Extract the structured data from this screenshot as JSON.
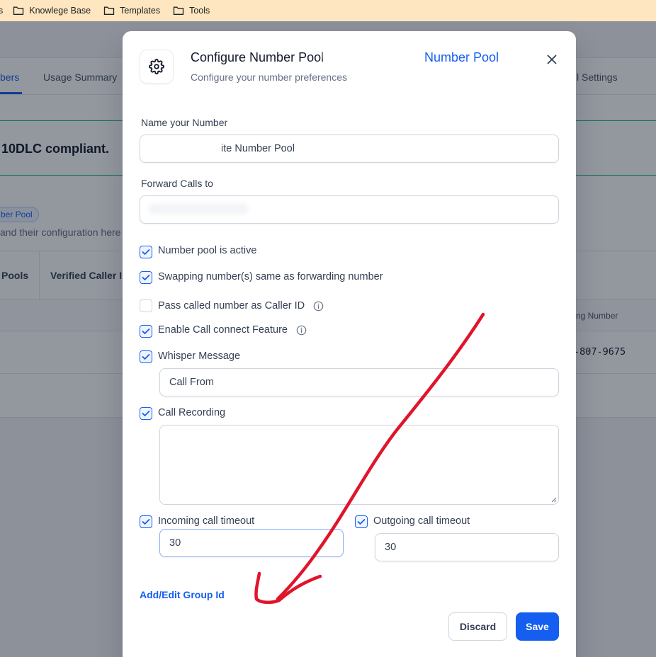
{
  "bookmarks": {
    "cut_label": "s",
    "items": [
      {
        "label": "Knowlege Base"
      },
      {
        "label": "Templates"
      },
      {
        "label": "Tools"
      }
    ]
  },
  "background": {
    "tabs": {
      "numbers": "bers",
      "usage": "Usage Summary",
      "settings": "l Settings"
    },
    "banner_text": "10DLC compliant.",
    "pill": "ber Pool",
    "desc": "and their configuration here",
    "subtabs": {
      "pools": "Pools",
      "caller": "Verified Caller I"
    },
    "column_header": "ng Number",
    "row_number": "-807-9675"
  },
  "modal": {
    "title": "Configure Number Pool",
    "title_suffix": "Number Pool",
    "subtitle": "Configure your number preferences",
    "name_label": "Name your Number",
    "name_value": "ite Number Pool",
    "forward_label": "Forward Calls to",
    "forward_value": "",
    "checkboxes": {
      "active": {
        "label": "Number pool is active",
        "checked": true
      },
      "swapping": {
        "label": "Swapping number(s) same as forwarding number",
        "checked": true
      },
      "caller_id": {
        "label": "Pass called number as Caller ID",
        "checked": false
      },
      "call_connect": {
        "label": "Enable Call connect Feature",
        "checked": true
      },
      "whisper": {
        "label": "Whisper Message",
        "checked": true
      },
      "recording": {
        "label": "Call Recording",
        "checked": true
      },
      "incoming": {
        "label": "Incoming call timeout",
        "checked": true
      },
      "outgoing": {
        "label": "Outgoing call timeout",
        "checked": true
      }
    },
    "whisper_value": "Call From",
    "recording_value": "",
    "incoming_timeout": "30",
    "outgoing_timeout": "30",
    "group_link": "Add/Edit Group Id",
    "discard": "Discard",
    "save": "Save"
  },
  "colors": {
    "accent": "#155eef",
    "annotation": "#e0142b",
    "bookmark_bar": "#fde6c0"
  },
  "icons": [
    "folder-icon",
    "gear-icon",
    "close-icon",
    "check-icon",
    "info-icon"
  ],
  "annotation": {
    "type": "red hand-drawn arrow"
  }
}
